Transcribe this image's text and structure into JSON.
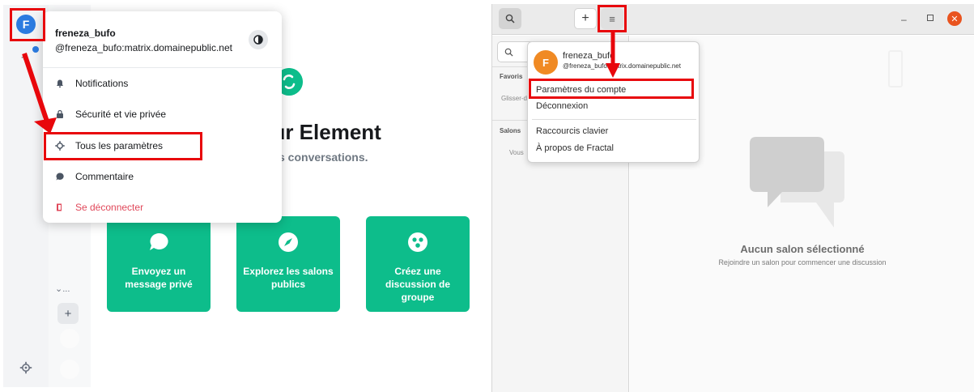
{
  "element": {
    "avatar_letter": "F",
    "plus_glyph": "+",
    "expand_glyph": "⌄...",
    "add_space_glyph": "+",
    "hero": {
      "title": "sur Element",
      "subtitle": "s conversations."
    },
    "cards": [
      {
        "label": "Envoyez un message privé",
        "icon": "chat-bubble-icon"
      },
      {
        "label": "Explorez les salons publics",
        "icon": "compass-icon"
      },
      {
        "label": "Créez une discussion de groupe",
        "icon": "group-icon"
      }
    ],
    "user_menu": {
      "display_name": "freneza_bufo",
      "matrix_id": "@freneza_bufo:matrix.domainepublic.net",
      "items": [
        {
          "label": "Notifications",
          "icon": "bell-icon"
        },
        {
          "label": "Sécurité et vie privée",
          "icon": "lock-icon"
        },
        {
          "label": "Tous les paramètres",
          "icon": "gear-icon"
        },
        {
          "label": "Commentaire",
          "icon": "feedback-icon"
        },
        {
          "label": "Se déconnecter",
          "icon": "logout-icon"
        }
      ]
    },
    "colors": {
      "accent": "#0dbd8b",
      "avatar": "#2c7be0",
      "danger": "#e0485a"
    }
  },
  "fractal": {
    "add_glyph": "+",
    "menu_glyph": "≡",
    "min_glyph": "–",
    "close_glyph": "✕",
    "sidebar": {
      "favorites_label": "Favoris",
      "favorites_hint": "Glisser-d",
      "rooms_label": "Salons",
      "rooms_hint": "Vous"
    },
    "main": {
      "empty_title": "Aucun salon sélectionné",
      "empty_subtitle": "Rejoindre un salon pour commencer une discussion"
    },
    "account_menu": {
      "avatar_letter": "F",
      "display_name": "freneza_bufo",
      "matrix_id": "@freneza_bufo:matrix.domainepublic.net",
      "items": [
        {
          "label": "Paramètres du compte"
        },
        {
          "label": "Déconnexion"
        },
        {
          "label": "Raccourcis clavier"
        },
        {
          "label": "À propos de Fractal"
        }
      ]
    },
    "colors": {
      "avatar": "#f08a24",
      "close": "#e9541f"
    }
  },
  "annotations": {
    "highlight_color": "#e8070c"
  }
}
